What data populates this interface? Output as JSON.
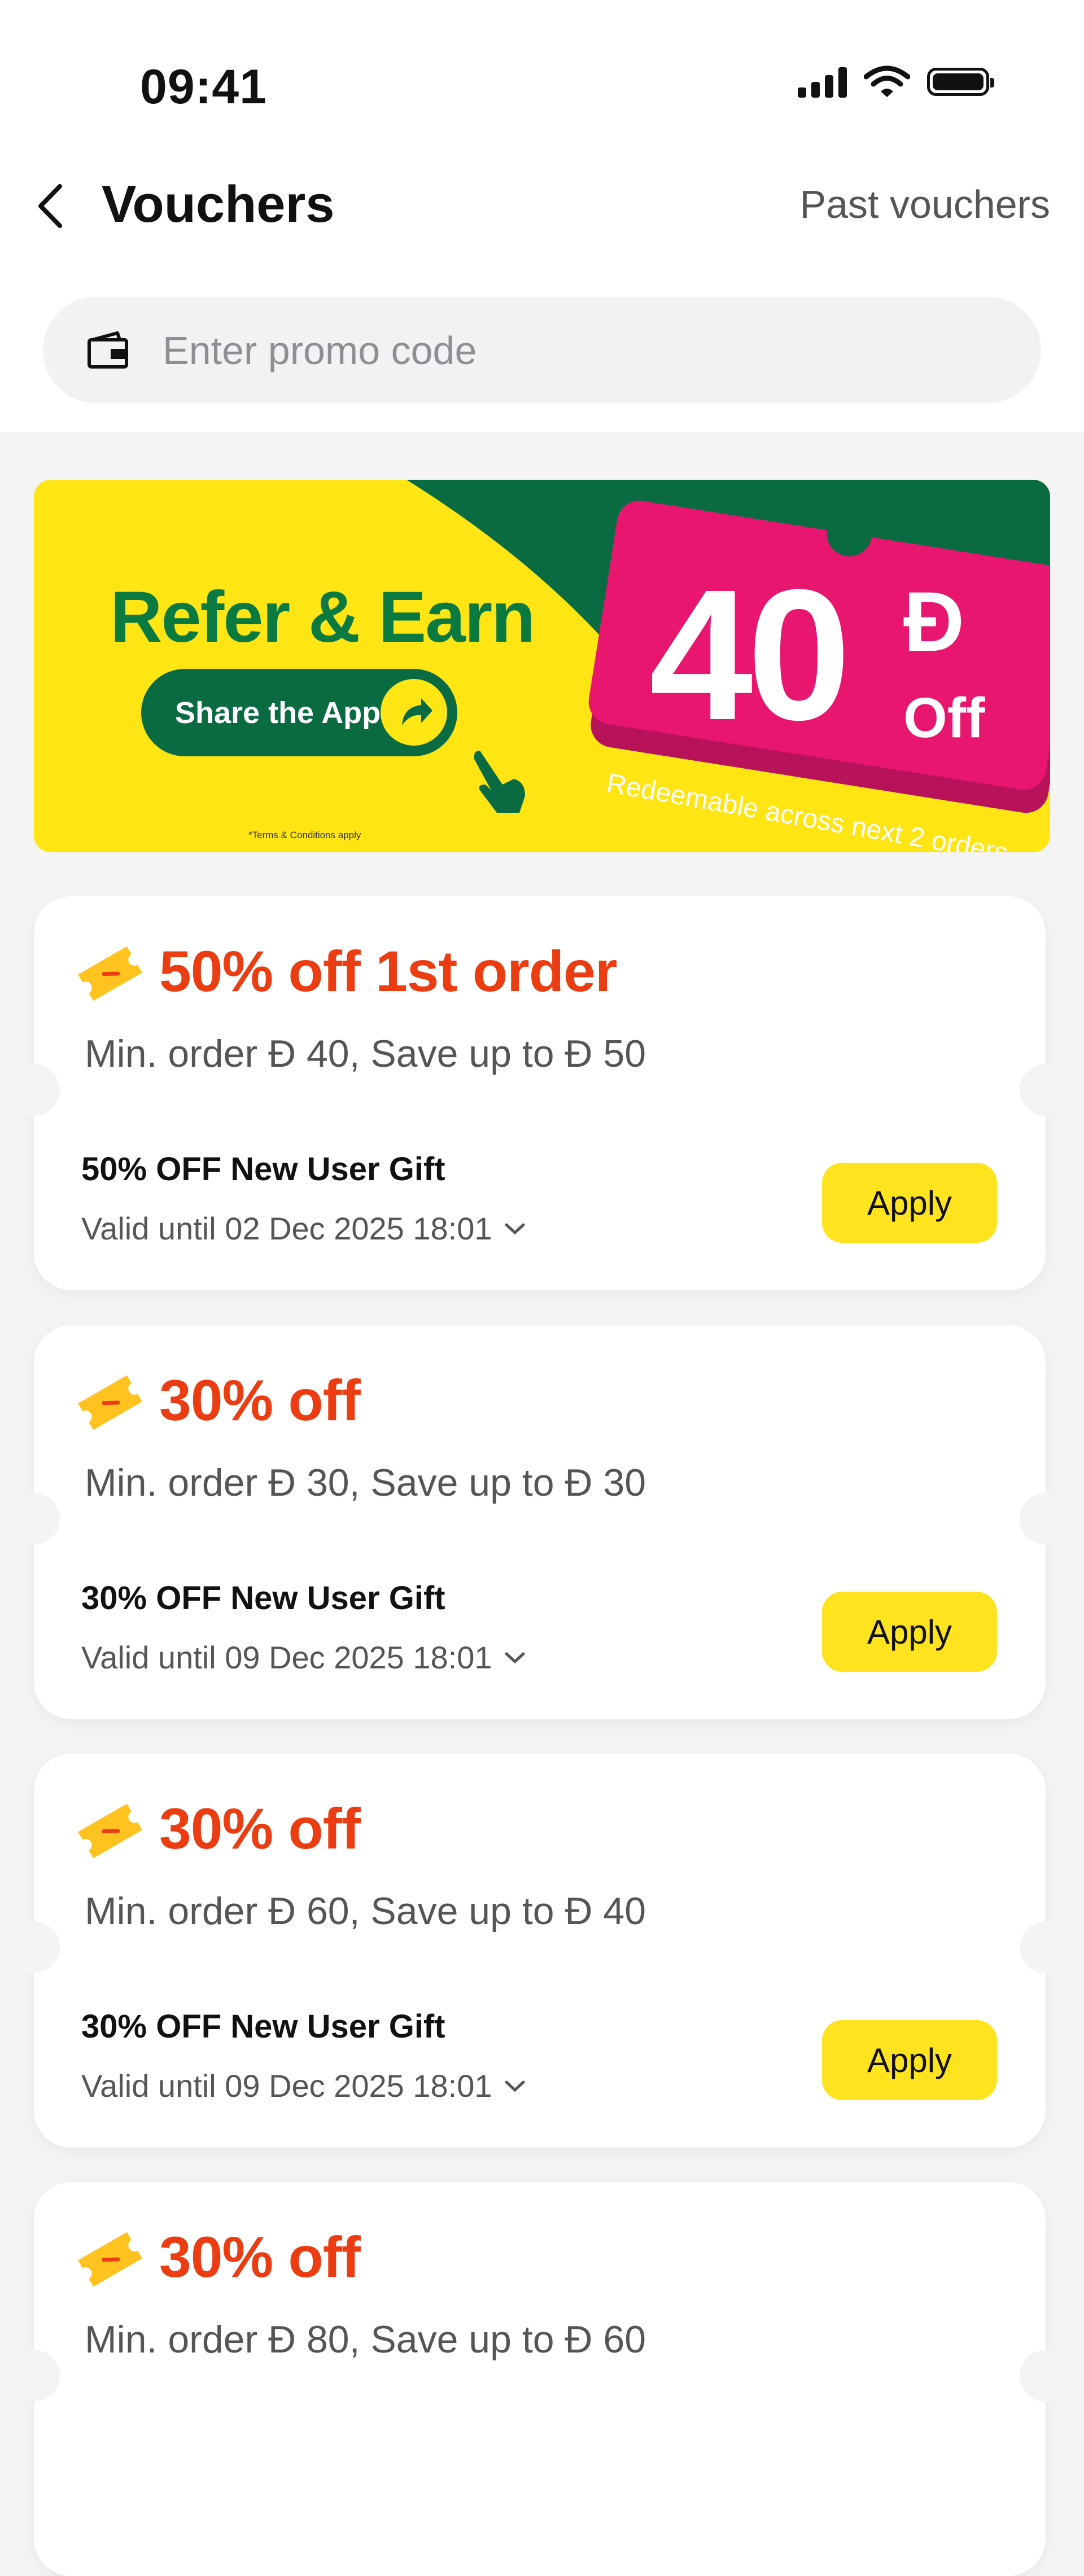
{
  "status_bar": {
    "time": "09:41",
    "icons": [
      "signal-icon",
      "wifi-icon",
      "battery-icon"
    ]
  },
  "header": {
    "back_icon": "chevron-left-icon",
    "title": "Vouchers",
    "past_link": "Past vouchers"
  },
  "promo": {
    "icon": "wallet-icon",
    "placeholder": "Enter promo code",
    "value": ""
  },
  "banner": {
    "title": "Refer & Earn",
    "button": "Share the App",
    "terms": "*Terms & Conditions apply",
    "amount": "40",
    "currency": "Ð",
    "off": "Off",
    "subtitle": "Redeemable across next 2 orders",
    "colors": {
      "yellow": "#ffe514",
      "green": "#0a6b43",
      "pink": "#e9166f"
    }
  },
  "vouchers": [
    {
      "headline": "50% off 1st order",
      "min_order": "Min. order Ð 40, Save up to Ð 50",
      "gift": "50% OFF New User Gift",
      "valid": "Valid until 02 Dec 2025 18:01",
      "apply": "Apply"
    },
    {
      "headline": "30% off",
      "min_order": "Min. order Ð 30, Save up to Ð 30",
      "gift": "30% OFF New User Gift",
      "valid": "Valid until 09 Dec 2025 18:01",
      "apply": "Apply"
    },
    {
      "headline": "30% off",
      "min_order": "Min. order Ð 60, Save up to Ð 40",
      "gift": "30% OFF New User Gift",
      "valid": "Valid until 09 Dec 2025 18:01",
      "apply": "Apply"
    },
    {
      "headline": "30% off",
      "min_order": "Min. order Ð 80, Save up to Ð 60"
    }
  ],
  "colors": {
    "accent": "#ec3c12",
    "apply": "#ffe31f",
    "background": "#f4f4f4"
  }
}
